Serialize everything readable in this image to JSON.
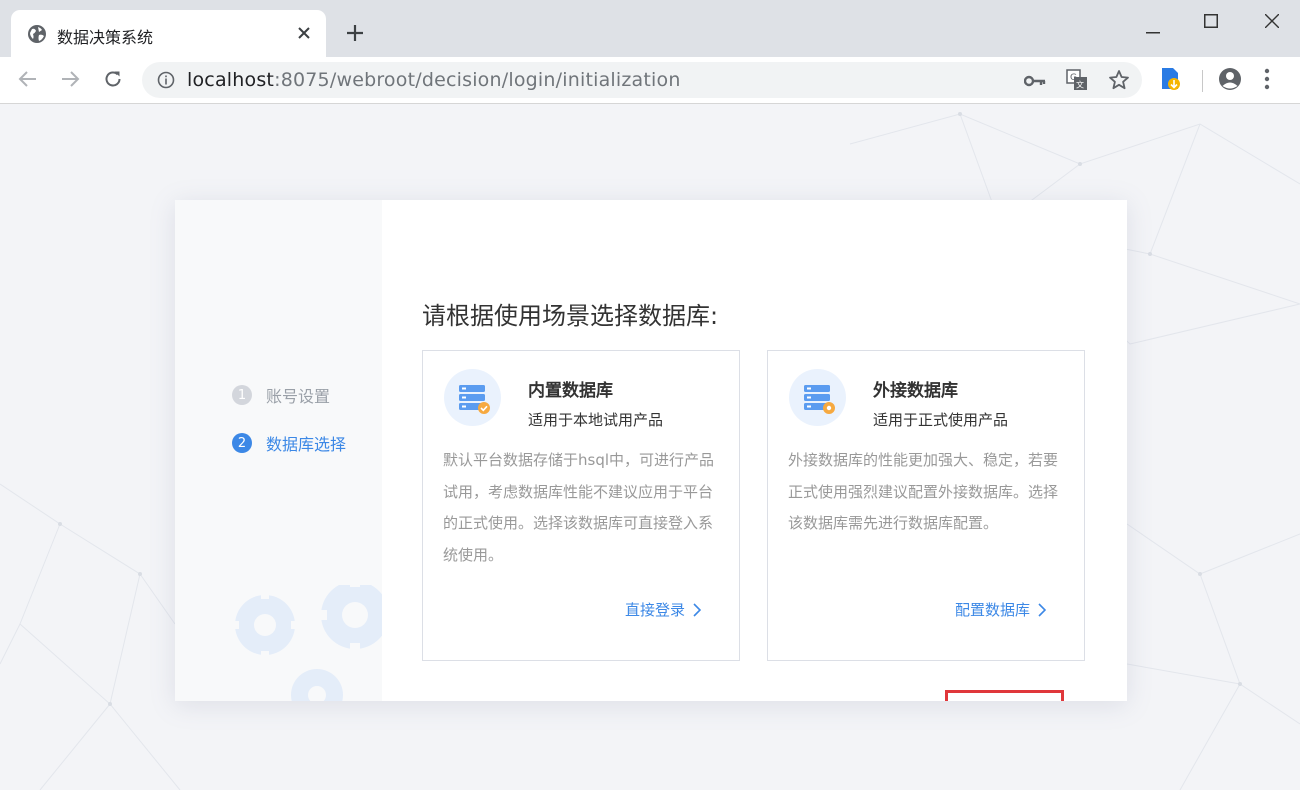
{
  "browser": {
    "tab_title": "数据决策系统",
    "url_host": "localhost",
    "url_rest": ":8075/webroot/decision/login/initialization",
    "icons": [
      "globe-icon",
      "close-icon",
      "plus-icon",
      "minimize-icon",
      "maximize-icon",
      "window-close-icon",
      "back-icon",
      "forward-icon",
      "reload-icon",
      "info-icon",
      "key-icon",
      "translate-icon",
      "star-icon",
      "extension-icon",
      "profile-icon",
      "menu-icon"
    ]
  },
  "sidebar": {
    "steps": [
      {
        "num": "1",
        "label": "账号设置"
      },
      {
        "num": "2",
        "label": "数据库选择"
      }
    ]
  },
  "main": {
    "heading": "请根据使用场景选择数据库:",
    "options": [
      {
        "title": "内置数据库",
        "subtitle": "适用于本地试用产品",
        "description": "默认平台数据存储于hsql中，可进行产品试用，考虑数据库性能不建议应用于平台的正式使用。选择该数据库可直接登入系统使用。",
        "link": "直接登录"
      },
      {
        "title": "外接数据库",
        "subtitle": "适用于正式使用产品",
        "description": "外接数据库的性能更加强大、稳定，若要正式使用强烈建议配置外接数据库。选择该数据库需先进行数据库配置。",
        "link": "配置数据库"
      }
    ]
  },
  "colors": {
    "accent": "#3c88e6",
    "highlight_box": "#e0373b",
    "muted_text": "#999999",
    "page_bg": "#f3f4f7"
  }
}
